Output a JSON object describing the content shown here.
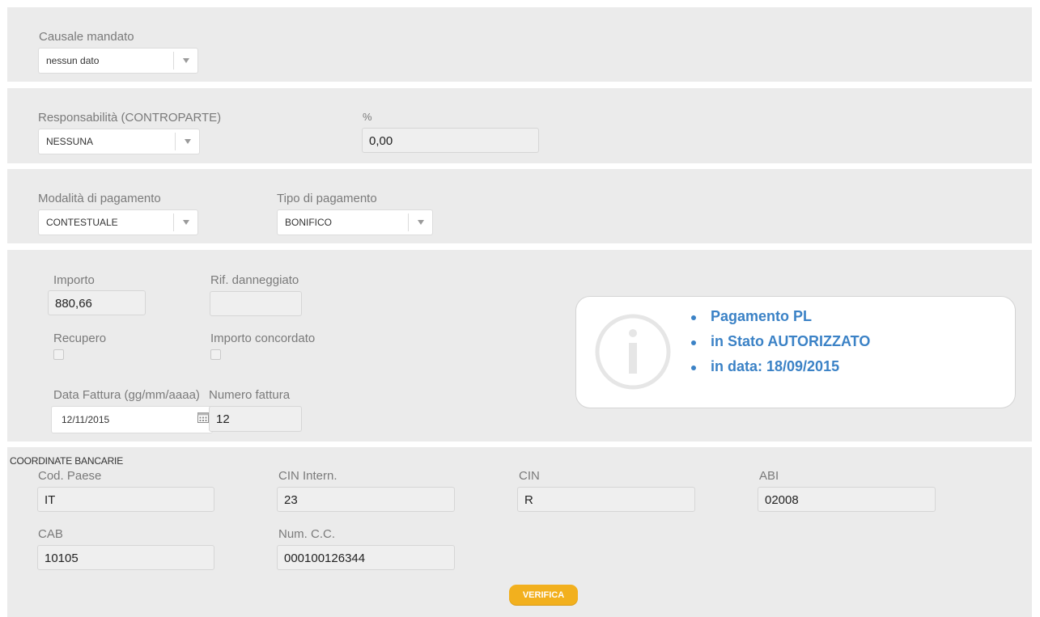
{
  "causale": {
    "label": "Causale mandato",
    "value": "nessun dato"
  },
  "responsabilita": {
    "label": "Responsabilità (CONTROPARTE)",
    "value": "NESSUNA",
    "percent_label": "%",
    "percent_value": "0,00"
  },
  "pagamento": {
    "modalita_label": "Modalità di pagamento",
    "modalita_value": "CONTESTUALE",
    "tipo_label": "Tipo di pagamento",
    "tipo_value": "BONIFICO"
  },
  "dettaglio": {
    "importo_label": "Importo",
    "importo_value": "880,66",
    "rif_label": "Rif. danneggiato",
    "rif_value": "",
    "recupero_label": "Recupero",
    "recupero_checked": false,
    "concordato_label": "Importo concordato",
    "concordato_checked": false,
    "data_label": "Data Fattura (gg/mm/aaaa)",
    "data_value": "12/11/2015",
    "numero_label": "Numero fattura",
    "numero_value": "12"
  },
  "info": {
    "icon": "info-icon",
    "items": [
      "Pagamento PL",
      "in Stato AUTORIZZATO",
      "in data: 18/09/2015"
    ],
    "color": "#3b82c6"
  },
  "coordinate": {
    "title": "COORDINATE BANCARIE",
    "cod_paese_label": "Cod. Paese",
    "cod_paese_value": "IT",
    "cin_intern_label": "CIN Intern.",
    "cin_intern_value": "23",
    "cin_label": "CIN",
    "cin_value": "R",
    "abi_label": "ABI",
    "abi_value": "02008",
    "cab_label": "CAB",
    "cab_value": "10105",
    "num_cc_label": "Num. C.C.",
    "num_cc_value": "000100126344",
    "verify_label": "VERIFICA"
  },
  "colors": {
    "accent": "#f2b01e",
    "panel": "#ebebeb",
    "info_text": "#3b82c6"
  }
}
